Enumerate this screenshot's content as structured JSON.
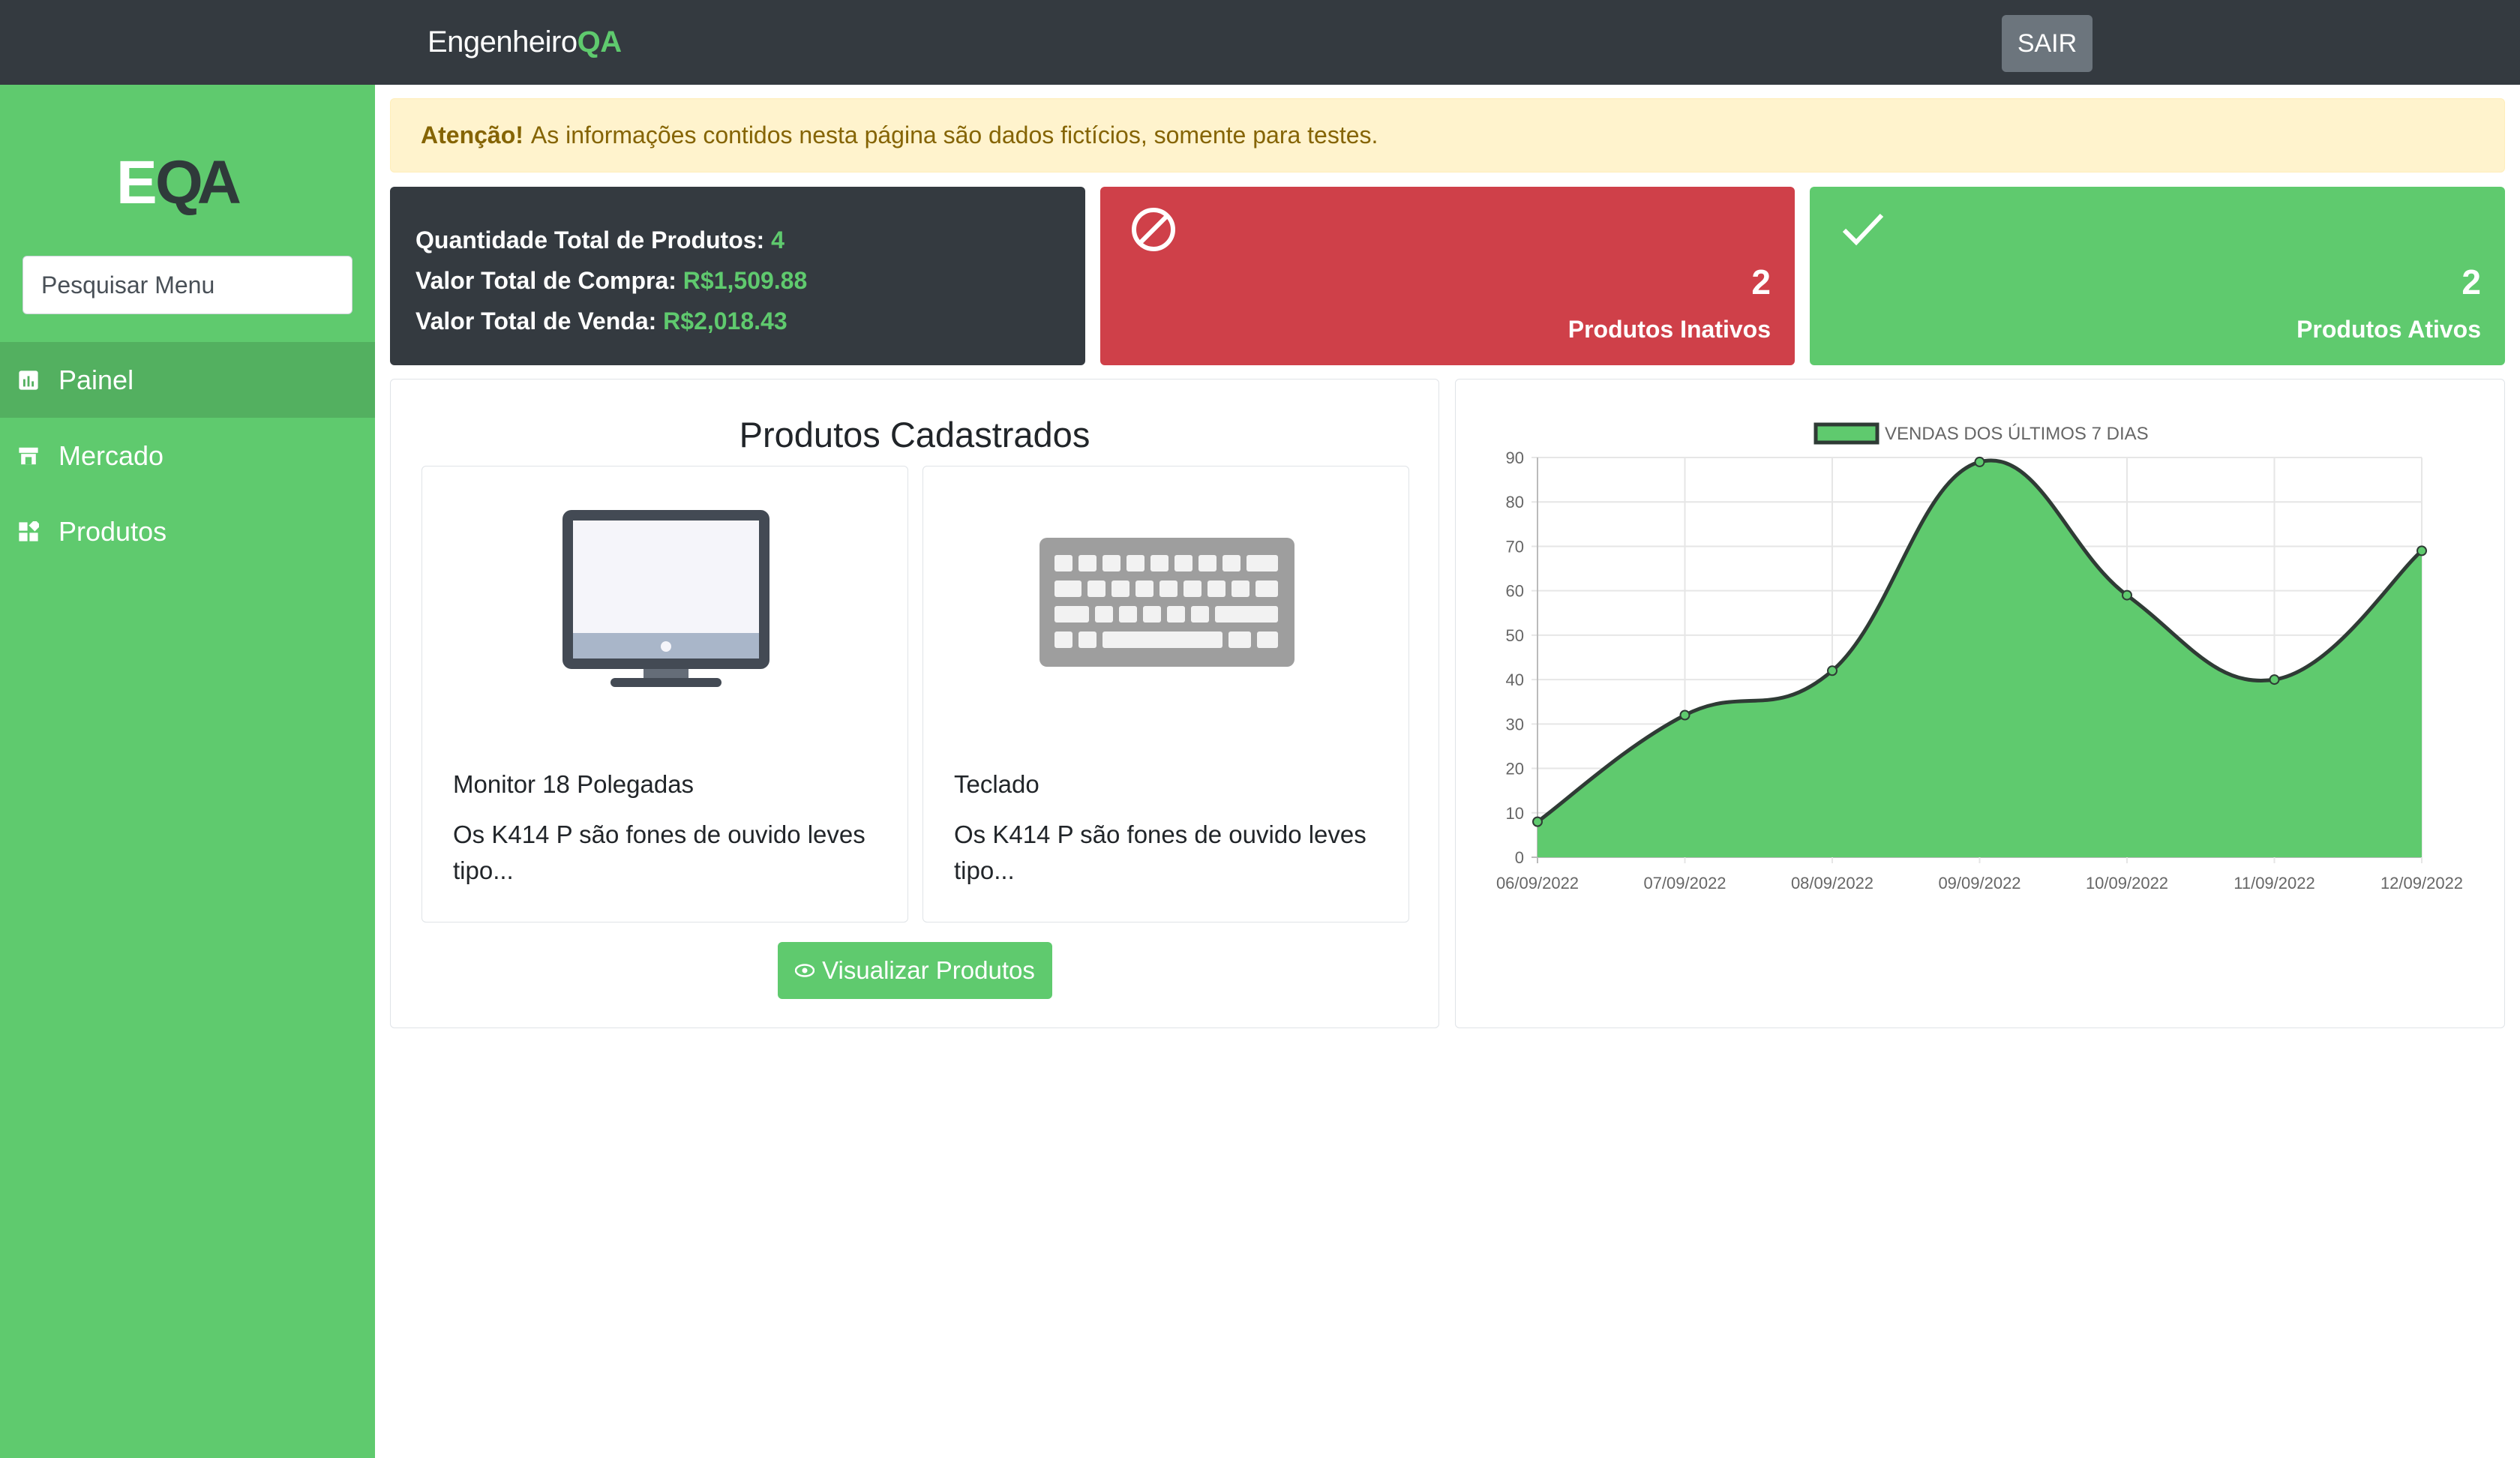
{
  "brand": {
    "name": "Engenheiro",
    "accent": "QA"
  },
  "header": {
    "logout_label": "SAIR"
  },
  "sidebar": {
    "logo_text": "EQA",
    "search_placeholder": "Pesquisar Menu",
    "items": [
      {
        "label": "Painel",
        "icon": "chart-icon",
        "active": true
      },
      {
        "label": "Mercado",
        "icon": "store-icon",
        "active": false
      },
      {
        "label": "Produtos",
        "icon": "grid-icon",
        "active": false
      }
    ]
  },
  "alert": {
    "strong": "Atenção!",
    "text": "As informações contidos nesta página são dados fictícios, somente para testes."
  },
  "summary": {
    "total_products_label": "Quantidade Total de Produtos:",
    "total_products_value": "4",
    "purchase_label": "Valor Total de Compra:",
    "purchase_value": "R$1,509.88",
    "sale_label": "Valor Total de Venda:",
    "sale_value": "R$2,018.43"
  },
  "inactive_card": {
    "count": "2",
    "label": "Produtos Inativos",
    "icon": "ban-icon"
  },
  "active_card": {
    "count": "2",
    "label": "Produtos Ativos",
    "icon": "check-icon"
  },
  "products": {
    "title": "Produtos Cadastrados",
    "items": [
      {
        "name": "Monitor 18 Polegadas",
        "description": "Os K414 P são fones de ouvido leves tipo...",
        "icon": "monitor-icon"
      },
      {
        "name": "Teclado",
        "description": "Os K414 P são fones de ouvido leves tipo...",
        "icon": "keyboard-icon"
      }
    ],
    "view_button": "Visualizar Produtos"
  },
  "colors": {
    "green": "#5fca6e",
    "dark": "#343a40",
    "red": "#cf4049",
    "alert_bg": "#fff3cd",
    "alert_text": "#856404"
  },
  "chart_data": {
    "type": "area",
    "legend": "VENDAS DOS ÚLTIMOS 7 DIAS",
    "categories": [
      "06/09/2022",
      "07/09/2022",
      "08/09/2022",
      "09/09/2022",
      "10/09/2022",
      "11/09/2022",
      "12/09/2022"
    ],
    "series": [
      {
        "name": "VENDAS DOS ÚLTIMOS 7 DIAS",
        "values": [
          8,
          32,
          42,
          89,
          59,
          40,
          69
        ]
      }
    ],
    "ylim": [
      0,
      90
    ],
    "yticks": [
      0,
      10,
      20,
      30,
      40,
      50,
      60,
      70,
      80,
      90
    ],
    "grid": true,
    "legend_position": "top",
    "fill_color": "#5fca6e",
    "line_color": "#2f3b35"
  }
}
